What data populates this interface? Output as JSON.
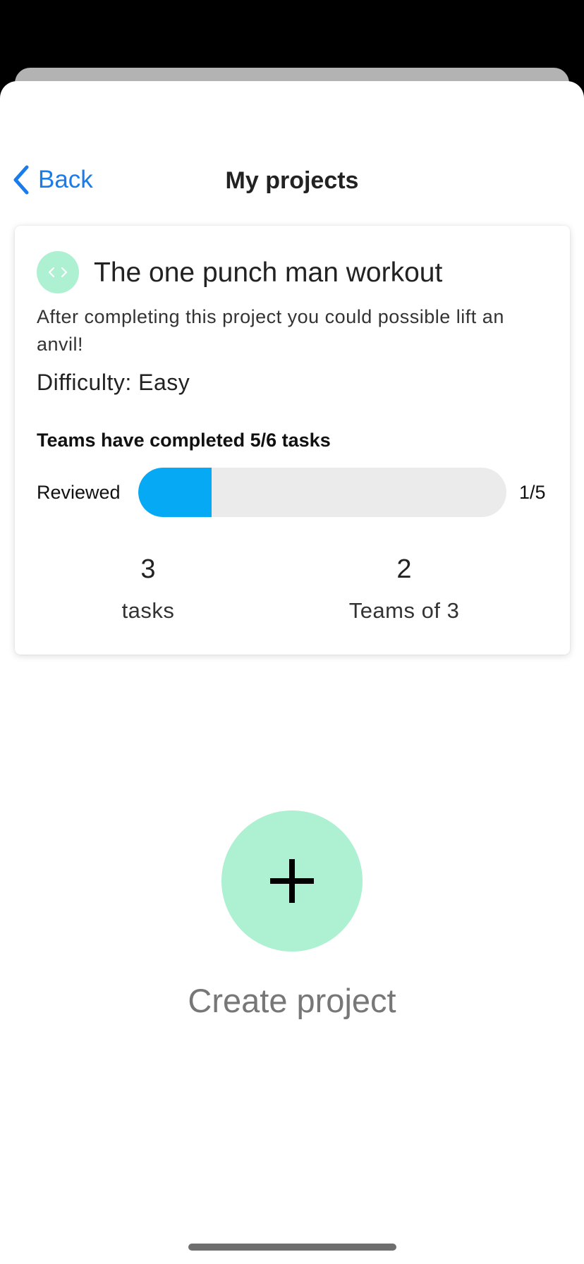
{
  "nav": {
    "back_label": "Back",
    "title": "My projects"
  },
  "project": {
    "icon": "code-brackets-icon",
    "title": "The one punch man workout",
    "description": "After completing this project you could possible lift an anvil!",
    "difficulty": "Difficulty: Easy",
    "completion_text": "Teams have completed 5/6 tasks",
    "review": {
      "label": "Reviewed",
      "count_text": "1/5",
      "progress_fraction": 0.2
    },
    "stats": [
      {
        "value": "3",
        "label": "tasks"
      },
      {
        "value": "2",
        "label": "Teams of 3"
      }
    ]
  },
  "create": {
    "icon": "plus-icon",
    "label": "Create project"
  },
  "colors": {
    "accent_blue": "#1a7bea",
    "progress_blue": "#06a9f4",
    "mint": "#aef0d2"
  }
}
